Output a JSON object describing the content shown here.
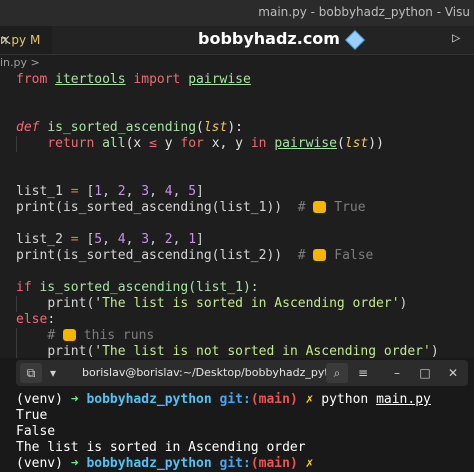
{
  "window": {
    "title": "main.py - bobbyhadz_python - Visu"
  },
  "tab": {
    "label": "n.py M",
    "close_glyph": "×"
  },
  "watermark": "bobbyhadz.com",
  "breadcrumb": "in.py >",
  "code": {
    "l1": [
      "from",
      "itertools",
      "import",
      "pairwise"
    ],
    "l2": [
      "def",
      "is_sorted_ascending",
      "(",
      "lst",
      "):"
    ],
    "l3": [
      "return",
      "all",
      "(x",
      "≤",
      "y",
      "for",
      "x, y",
      "in",
      "pairwise",
      "(",
      "lst",
      "))"
    ],
    "l4": [
      "list_1",
      "=",
      "[",
      "1",
      "2",
      "3",
      "4",
      "5",
      "]"
    ],
    "l5": [
      "print(is_sorted_ascending(list_1))",
      "#",
      "True"
    ],
    "l6": [
      "list_2",
      "=",
      "[",
      "5",
      "4",
      "3",
      "2",
      "1",
      "]"
    ],
    "l7": [
      "print(is_sorted_ascending(list_2))",
      "#",
      "False"
    ],
    "l8": [
      "if",
      "is_sorted_ascending(list_1):"
    ],
    "l9": [
      "print(",
      "'The list is sorted in Ascending order'",
      ")"
    ],
    "l10": [
      "else",
      ":"
    ],
    "l11": [
      "#",
      "this runs"
    ],
    "l12": [
      "print(",
      "'The list is not sorted in Ascending order'",
      ")"
    ]
  },
  "terminal": {
    "title": "borislav@borislav:~/Desktop/bobbyhadz_pyt...",
    "prompt": {
      "venv": "(venv)",
      "arrow": "➜",
      "dir": "bobbyhadz_python",
      "git": "git:",
      "branch": "(main)",
      "x": "✗",
      "cmd": "python",
      "file": "main.py"
    },
    "output": [
      "True",
      "False",
      "The list is sorted in Ascending order"
    ]
  },
  "colors": {
    "background": "#1e1e1e",
    "keyword": "#ef6b73",
    "function": "#a6e3a1",
    "number": "#c792ea",
    "string": "#c3e88d",
    "comment": "#7d7d7d"
  }
}
